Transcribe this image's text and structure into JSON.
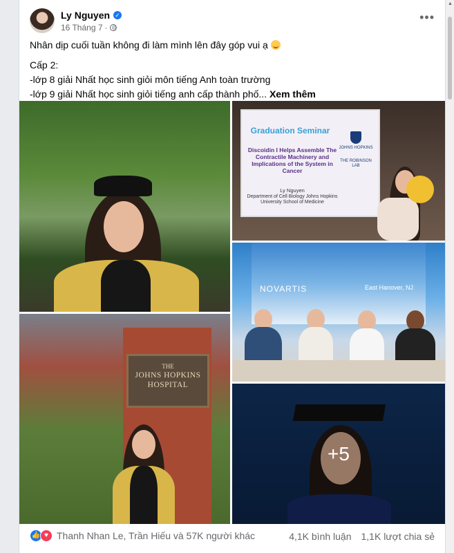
{
  "post": {
    "author": "Ly Nguyen",
    "date": "16 Tháng 7",
    "separator": "·",
    "lines": [
      "Nhân dịp cuối tuần không đi làm mình lên đây góp vui ạ",
      "Cấp 2:",
      "-lớp 8 giải Nhất học sinh giỏi môn tiếng Anh toàn trường",
      "-lớp 9 giải Nhất học sinh giỏi tiếng anh cấp thành phố..."
    ],
    "see_more": "Xem thêm"
  },
  "photos": {
    "slide": {
      "title": "Graduation Seminar",
      "subtitle": "Discoidin I Helps Assemble The Contractile Machinery and Implications of the System in Cancer",
      "author": "Ly Nguyen",
      "affiliation": "Department of Cell Biology Johns Hopkins University School of Medicine",
      "logo": "JOHNS HOPKINS",
      "lab": "THE ROBINSON LAB"
    },
    "novartis": {
      "brand": "NOVARTIS",
      "location": "East Hanover, NJ"
    },
    "hospital_sign": {
      "line1": "THE",
      "line2": "JOHNS HOPKINS",
      "line3": "HOSPITAL"
    },
    "more_count": "+5"
  },
  "footer": {
    "reactors": "Thanh Nhan Le, Trần Hiếu và 57K người khác",
    "comments": "4,1K bình luận",
    "shares": "1,1K lượt chia sẻ"
  },
  "icons": {
    "like": "like-icon",
    "love": "love-icon",
    "verified": "verified-icon",
    "globe": "globe-icon",
    "more": "more-options-icon"
  }
}
